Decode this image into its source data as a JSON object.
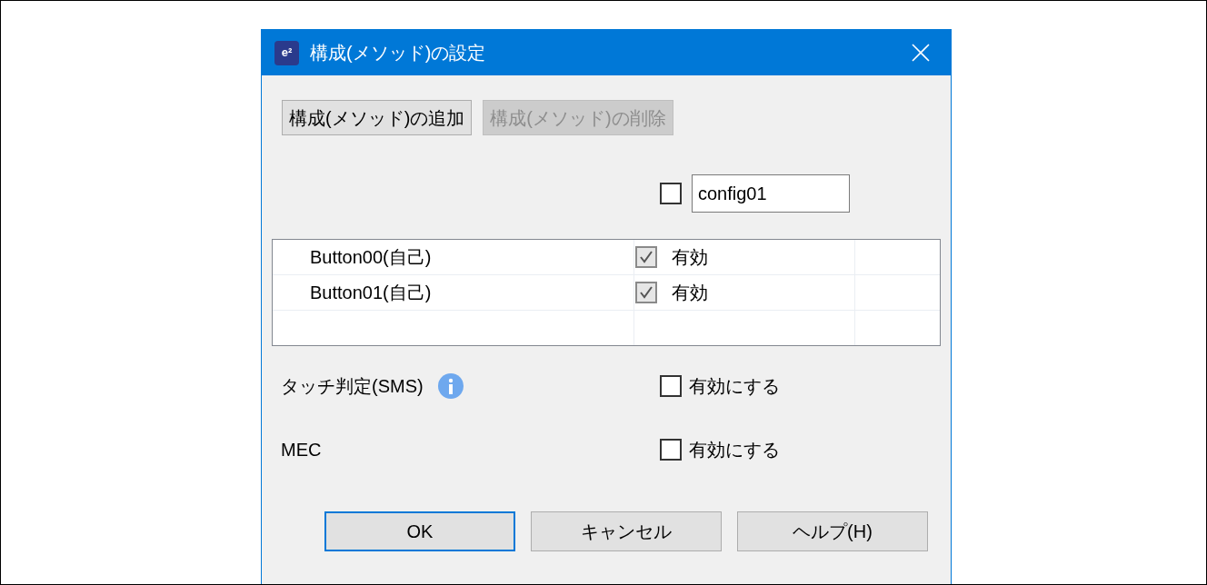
{
  "window": {
    "title": "構成(メソッド)の設定",
    "logo": "e²"
  },
  "toolbar": [
    {
      "label": "構成(メソッド)の追加",
      "disabled": false
    },
    {
      "label": "構成(メソッド)の削除",
      "disabled": true
    }
  ],
  "config": {
    "checked": false,
    "value": "config01"
  },
  "table": {
    "rows": [
      {
        "name": "Button00(自己)",
        "checked": true,
        "label": "有効"
      },
      {
        "name": "Button01(自己)",
        "checked": true,
        "label": "有効"
      }
    ]
  },
  "options": [
    {
      "label": "タッチ判定(SMS)",
      "info": true,
      "checked": false,
      "checkbox_label": "有効にする"
    },
    {
      "label": "MEC",
      "info": false,
      "checked": false,
      "checkbox_label": "有効にする"
    }
  ],
  "buttons": [
    {
      "label": "OK",
      "default": true
    },
    {
      "label": "キャンセル",
      "default": false
    },
    {
      "label": "ヘルプ(H)",
      "default": false
    }
  ]
}
